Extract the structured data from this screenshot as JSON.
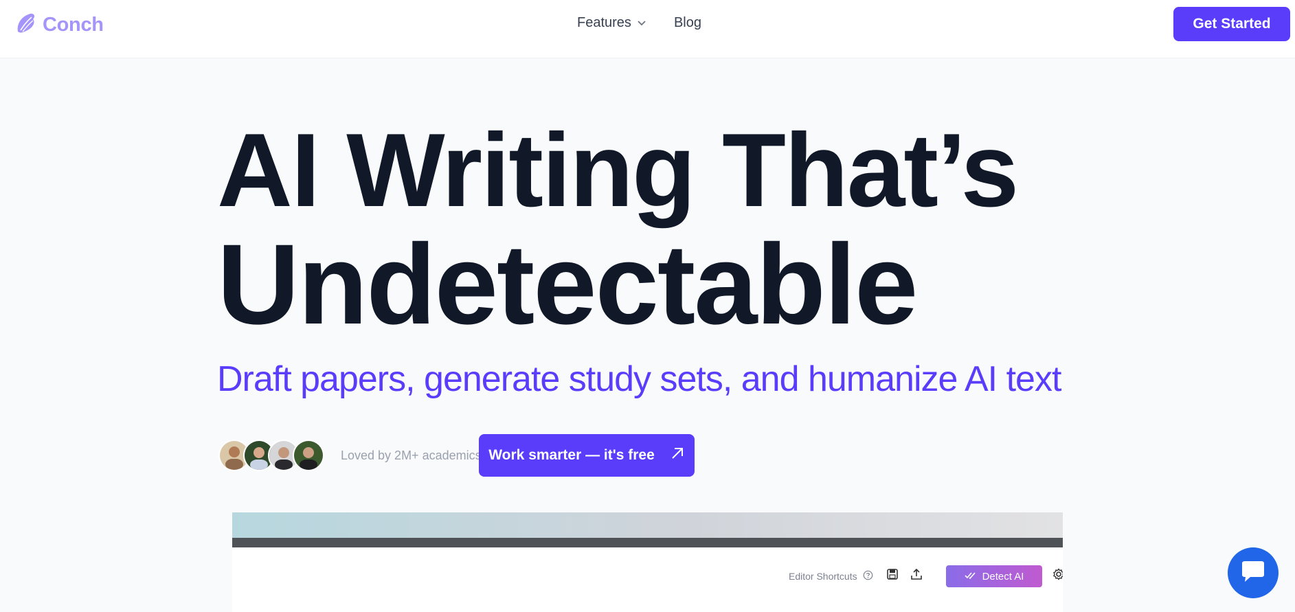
{
  "brand": {
    "name": "Conch",
    "logo_icon": "conch-shell-icon"
  },
  "nav": {
    "features": "Features",
    "blog": "Blog",
    "cta": "Get Started"
  },
  "hero": {
    "line1": "AI Writing That’s",
    "line2": "Undetectable",
    "subtitle": "Draft papers, generate study sets, and humanize AI text",
    "social_proof": "Loved by 2M+ academics",
    "cta": "Work smarter — it's free"
  },
  "editor_preview": {
    "shortcuts": "Editor Shortcuts",
    "detect_ai": "Detect AI"
  },
  "colors": {
    "accent": "#5a3dfb",
    "logo": "#a594f9",
    "chat_bubble": "#2166e8"
  }
}
